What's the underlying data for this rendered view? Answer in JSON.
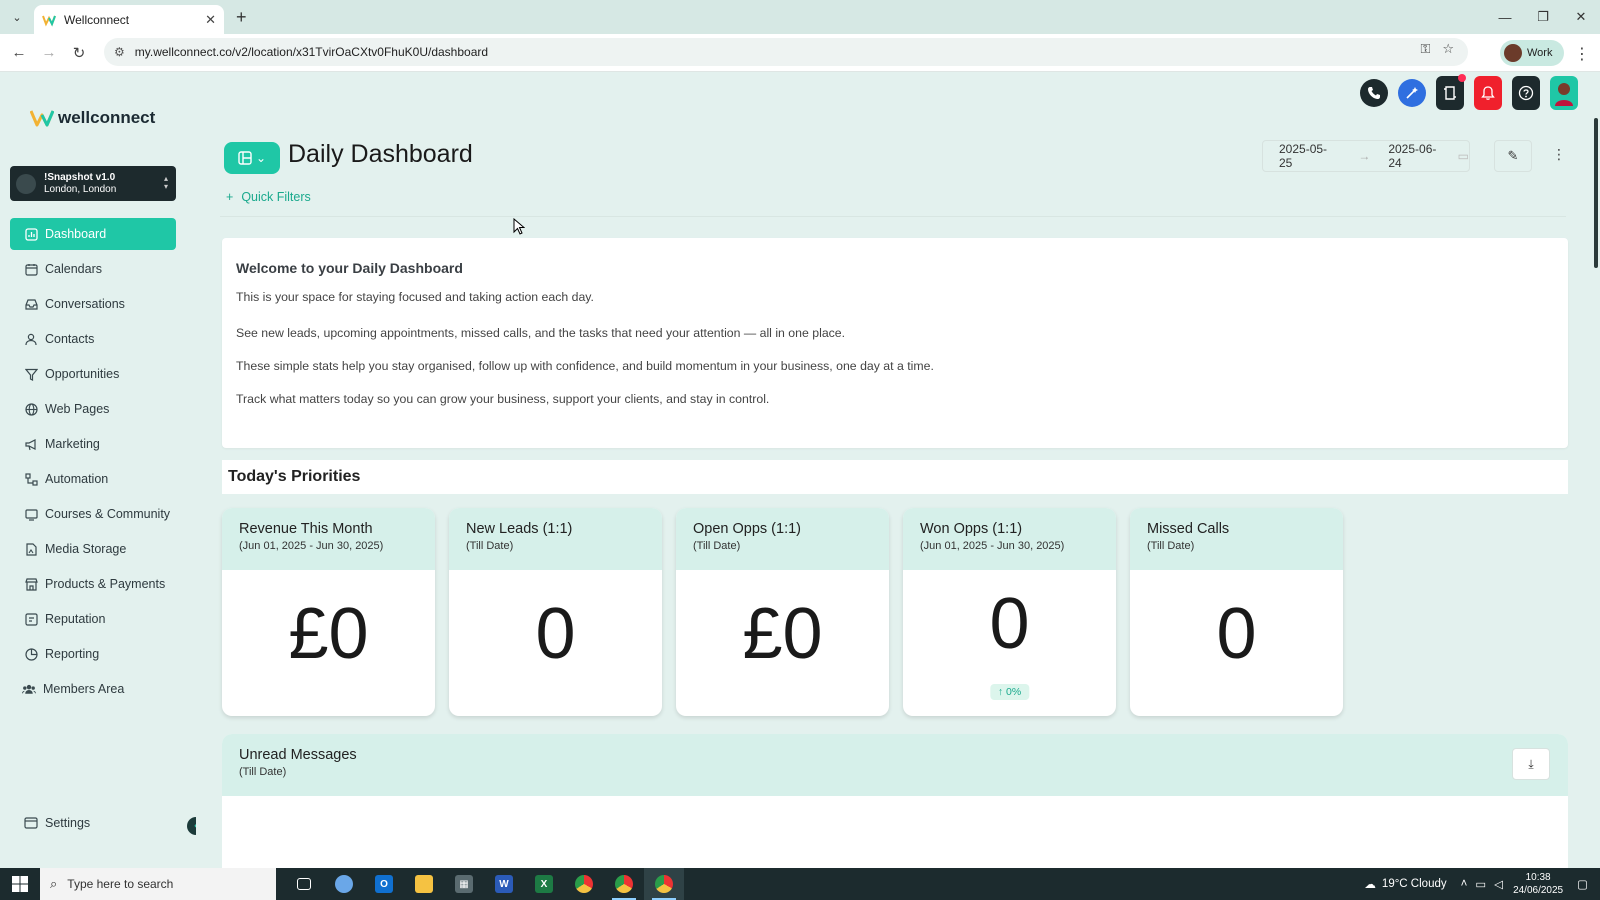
{
  "browser": {
    "tab_title": "Wellconnect",
    "tab_close": "✕",
    "new_tab": "+",
    "url": "my.wellconnect.co/v2/location/x31TvirOaCXtv0FhuK0U/dashboard",
    "profile_label": "Work"
  },
  "sidebar": {
    "brand": "wellconnect",
    "location_name": "!Snapshot v1.0",
    "location_city": "London, London",
    "items": [
      {
        "label": "Dashboard",
        "icon": "dashboard-icon",
        "active": true
      },
      {
        "label": "Calendars",
        "icon": "calendar-icon"
      },
      {
        "label": "Conversations",
        "icon": "inbox-icon"
      },
      {
        "label": "Contacts",
        "icon": "contact-icon"
      },
      {
        "label": "Opportunities",
        "icon": "filter-icon"
      },
      {
        "label": "Web Pages",
        "icon": "globe-icon"
      },
      {
        "label": "Marketing",
        "icon": "megaphone-icon"
      },
      {
        "label": "Automation",
        "icon": "automation-icon"
      },
      {
        "label": "Courses & Community",
        "icon": "courses-icon"
      },
      {
        "label": "Media Storage",
        "icon": "media-icon"
      },
      {
        "label": "Products & Payments",
        "icon": "store-icon"
      },
      {
        "label": "Reputation",
        "icon": "reputation-icon"
      },
      {
        "label": "Reporting",
        "icon": "reporting-icon"
      },
      {
        "label": "Members Area",
        "icon": "members-icon"
      }
    ],
    "settings_label": "Settings"
  },
  "header": {
    "title": "Daily Dashboard",
    "quick_filters": "Quick Filters",
    "date_start": "2025-05-25",
    "date_end": "2025-06-24"
  },
  "welcome": {
    "heading": "Welcome to your Daily Dashboard",
    "lines": [
      "This is your space for staying focused and taking action each day.",
      "See new leads, upcoming appointments, missed calls, and the tasks that need your attention — all in one place.",
      "These simple stats help you stay organised, follow up with confidence, and build momentum in your business, one day at a time.",
      "Track what matters today so you can grow your business, support your clients, and stay in control."
    ]
  },
  "priorities": {
    "heading": "Today's Priorities",
    "cards": [
      {
        "title": "Revenue This Month",
        "subtitle": "(Jun 01, 2025 - Jun 30, 2025)",
        "value": "£0"
      },
      {
        "title": "New Leads (1:1)",
        "subtitle": "(Till Date)",
        "value": "0"
      },
      {
        "title": "Open Opps (1:1)",
        "subtitle": "(Till Date)",
        "value": "£0"
      },
      {
        "title": "Won Opps (1:1)",
        "subtitle": "(Jun 01, 2025 - Jun 30, 2025)",
        "value": "0",
        "change": "↑ 0%"
      },
      {
        "title": "Missed Calls",
        "subtitle": "(Till Date)",
        "value": "0"
      }
    ]
  },
  "unread": {
    "title": "Unread Messages",
    "subtitle": "(Till Date)"
  },
  "taskbar": {
    "search_placeholder": "Type here to search",
    "weather": "19°C  Cloudy",
    "time": "10:38",
    "date": "24/06/2025"
  },
  "colors": {
    "accent": "#1fc7a6",
    "background": "#e3f1ee",
    "card_header": "#d6f0ea",
    "sidebar_dark": "#1d2a2d"
  }
}
